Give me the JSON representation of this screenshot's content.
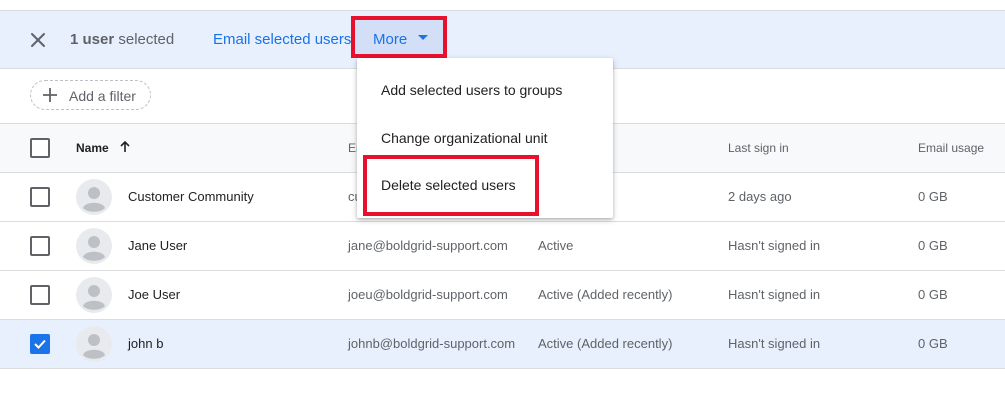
{
  "toolbar": {
    "selected_count": "1 user",
    "selected_suffix": " selected",
    "email_selected": "Email selected users",
    "more_label": "More"
  },
  "filter": {
    "label": "Add a filter"
  },
  "table": {
    "headers": {
      "name": "Name",
      "email": "Em",
      "last_sign_in": "Last sign in",
      "email_usage": "Email usage"
    },
    "rows": [
      {
        "name": "Customer Community",
        "email": "cu",
        "status": "",
        "last_sign_in": "2 days ago",
        "usage": "0 GB",
        "checked": false
      },
      {
        "name": "Jane User",
        "email": "jane@boldgrid-support.com",
        "status": "Active",
        "last_sign_in": "Hasn't signed in",
        "usage": "0 GB",
        "checked": false
      },
      {
        "name": "Joe User",
        "email": "joeu@boldgrid-support.com",
        "status": "Active (Added recently)",
        "last_sign_in": "Hasn't signed in",
        "usage": "0 GB",
        "checked": false
      },
      {
        "name": "john b",
        "email": "johnb@boldgrid-support.com",
        "status": "Active (Added recently)",
        "last_sign_in": "Hasn't signed in",
        "usage": "0 GB",
        "checked": true
      }
    ]
  },
  "menu": {
    "items": [
      "Add selected users to groups",
      "Change organizational unit",
      "Delete selected users"
    ]
  },
  "colors": {
    "accent": "#1a73e8",
    "selection_bg": "#e8f0fe",
    "highlight": "#e8112d"
  }
}
